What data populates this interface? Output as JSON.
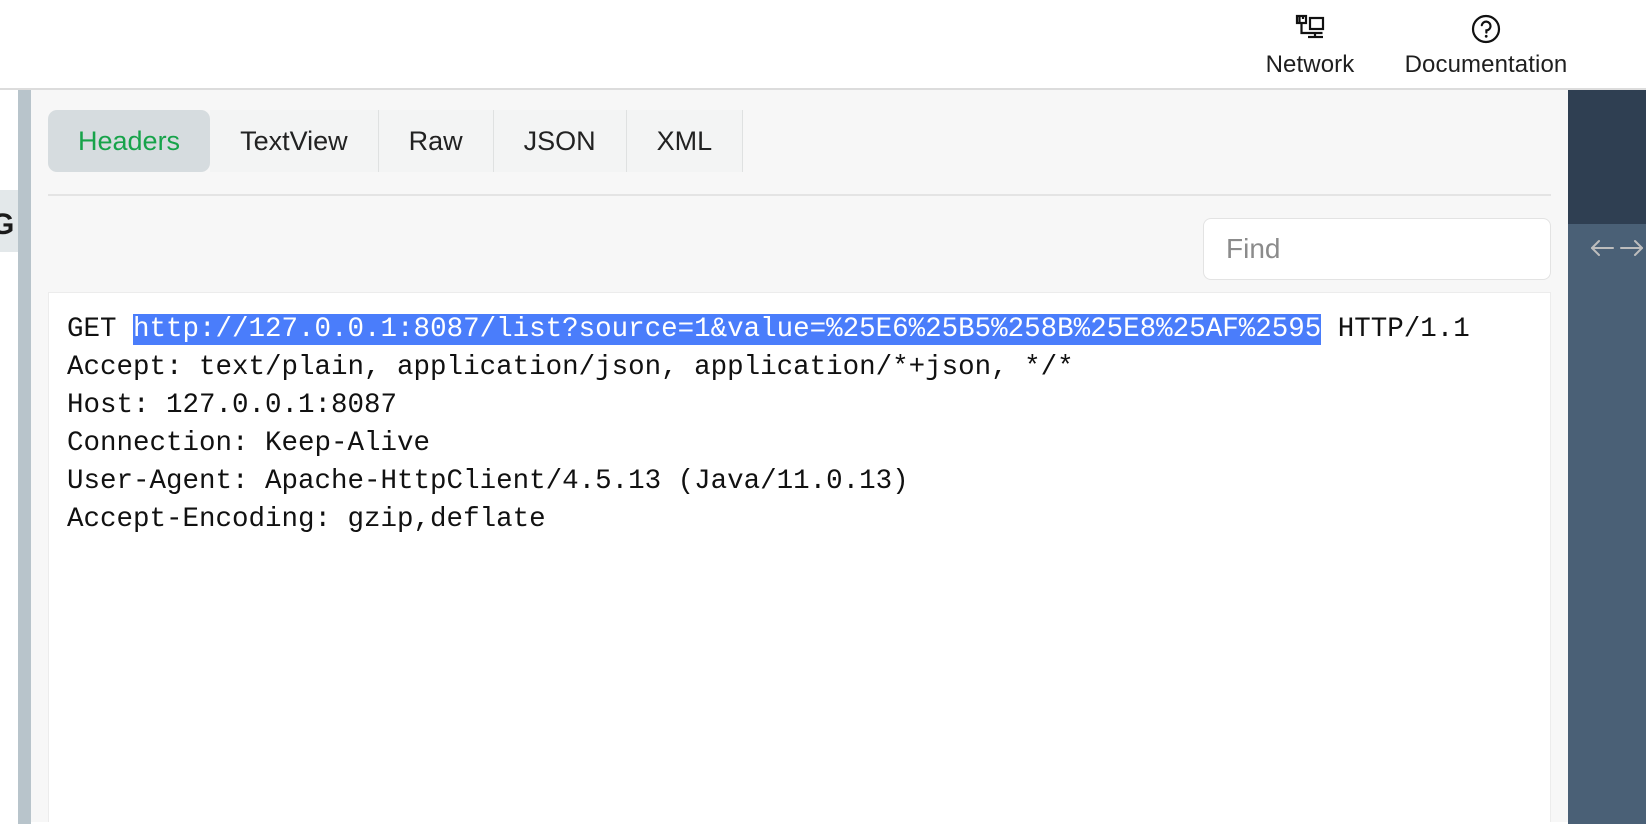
{
  "topbar": {
    "actions": [
      {
        "label": "Network",
        "icon": "network-icon"
      },
      {
        "label": "Documentation",
        "icon": "question-circle-icon"
      }
    ]
  },
  "left_stub": {
    "partial_glyph": "G"
  },
  "tabs": {
    "items": [
      {
        "label": "Headers",
        "active": true
      },
      {
        "label": "TextView",
        "active": false
      },
      {
        "label": "Raw",
        "active": false
      },
      {
        "label": "JSON",
        "active": false
      },
      {
        "label": "XML",
        "active": false
      }
    ],
    "active_color": "#17a34a",
    "active_bg": "#d6dcdf"
  },
  "find": {
    "value": "",
    "placeholder": "Find",
    "prev_icon": "arrow-left-icon",
    "next_icon": "arrow-right-icon",
    "search_icon": "search-icon",
    "search_icon_color": "#1a9e2e"
  },
  "headers": {
    "request_line": {
      "method": "GET ",
      "url": "http://127.0.0.1:8087/list?source=1&value=%25E6%25B5%258B%25E8%25AF%2595",
      "version": " HTTP/1.1",
      "url_highlighted": true,
      "highlight_bg": "#4a7dfb",
      "highlight_fg": "#ffffff"
    },
    "lines": [
      "Accept: text/plain, application/json, application/*+json, */*",
      "Host: 127.0.0.1:8087",
      "Connection: Keep-Alive",
      "User-Agent: Apache-HttpClient/4.5.13 (Java/11.0.13)",
      "Accept-Encoding: gzip,deflate"
    ]
  },
  "rail": {
    "top_color": "#2f3f52",
    "bottom_color": "#4a6076"
  }
}
